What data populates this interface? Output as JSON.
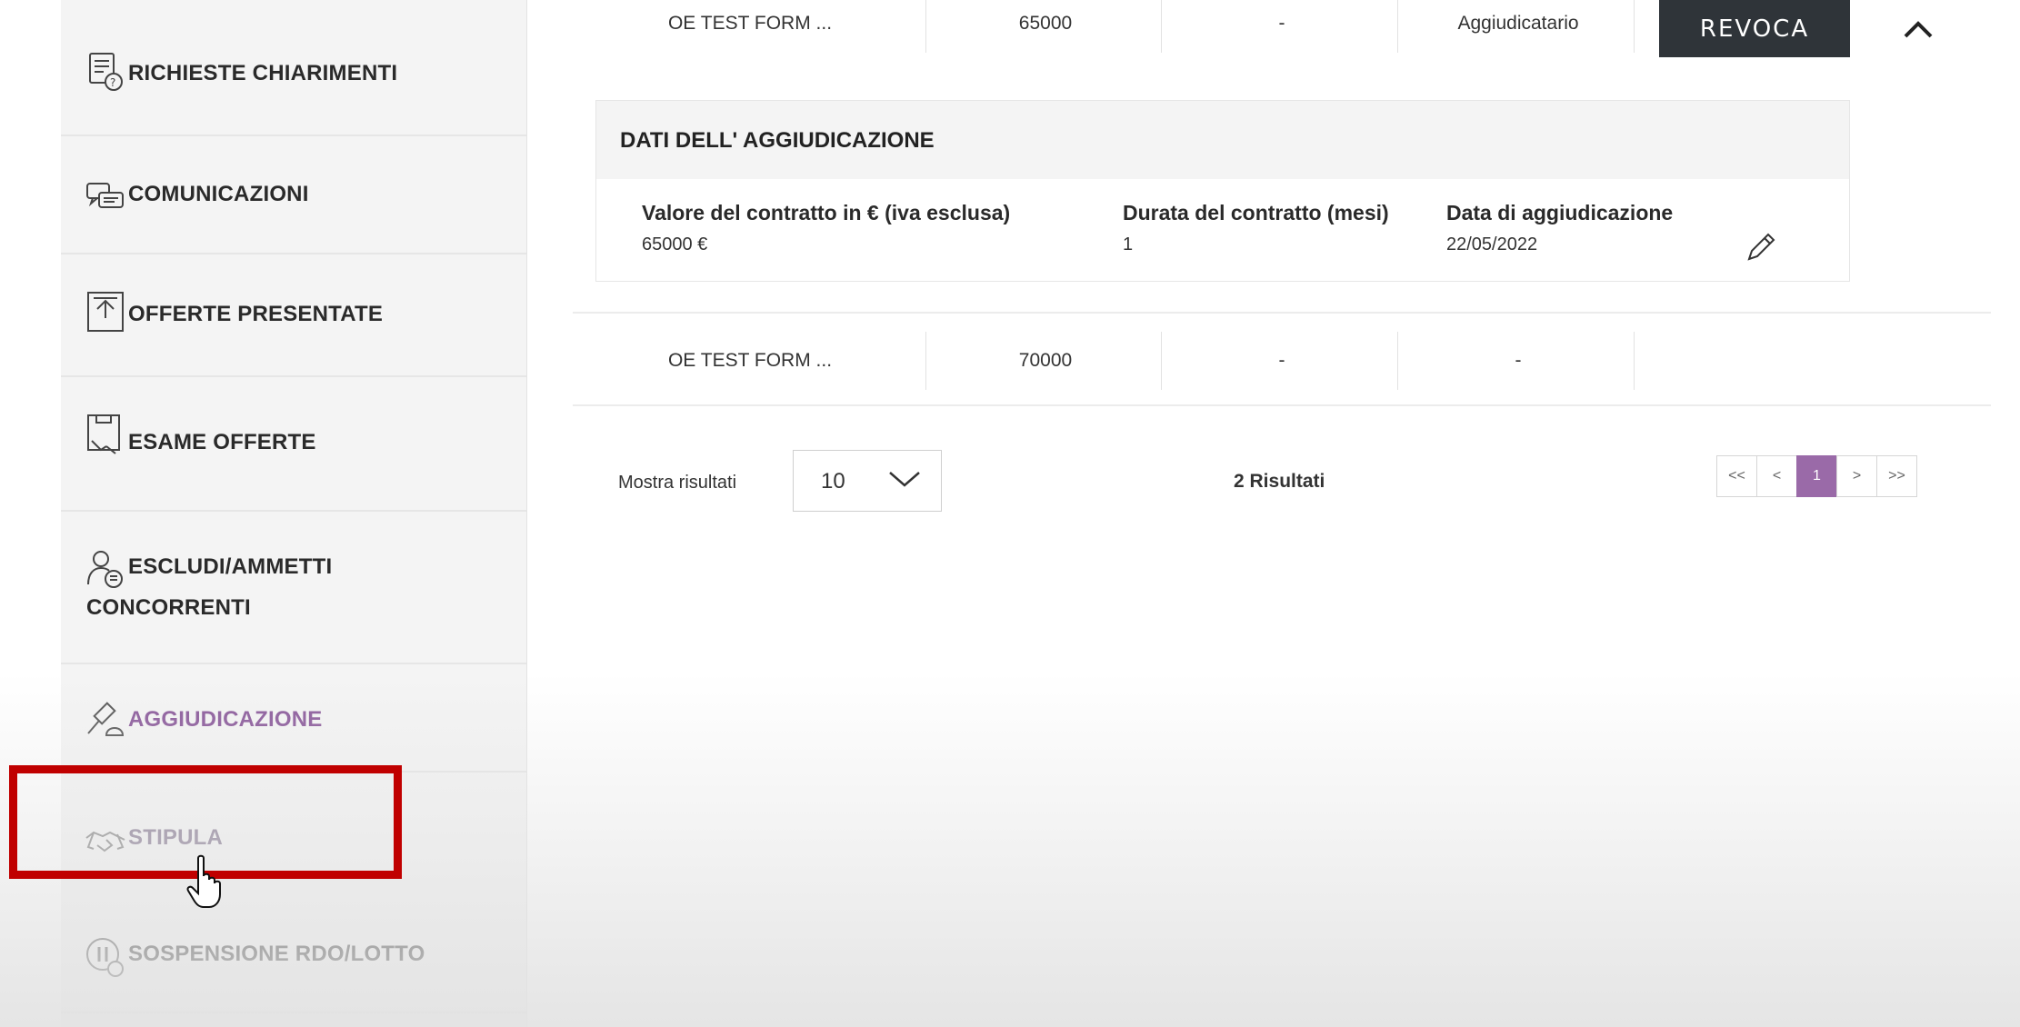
{
  "sidebar": {
    "items": [
      {
        "label": "RICHIESTE CHIARIMENTI",
        "icon": "document-question-icon"
      },
      {
        "label": "COMUNICAZIONI",
        "icon": "chat-bubbles-icon"
      },
      {
        "label": "OFFERTE PRESENTATE",
        "icon": "offer-envelope-icon"
      },
      {
        "label": "ESAME OFFERTE",
        "icon": "document-review-icon"
      },
      {
        "label": "ESCLUDI/AMMETTI CONCORRENTI",
        "icon": "user-list-icon"
      },
      {
        "label": "AGGIUDICAZIONE",
        "icon": "gavel-icon",
        "active": true
      },
      {
        "label": "STIPULA",
        "icon": "handshake-icon",
        "highlighted": true
      },
      {
        "label": "SOSPENSIONE RDO/LOTTO",
        "icon": "pause-circle-icon"
      }
    ]
  },
  "results": {
    "rows": [
      {
        "operatore": "OE TEST FORM ...",
        "offerta": "65000",
        "col3": "-",
        "stato": "Aggiudicatario",
        "action": "REVOCA"
      },
      {
        "operatore": "OE TEST FORM ...",
        "offerta": "70000",
        "col3": "-",
        "stato": "-"
      }
    ],
    "aggiudicazione": {
      "title": "DATI DELL' AGGIUDICAZIONE",
      "valore_label": "Valore del contratto in € (iva esclusa)",
      "valore": "65000 €",
      "durata_label": "Durata del contratto (mesi)",
      "durata": "1",
      "data_label": "Data di aggiudicazione",
      "data": "22/05/2022"
    }
  },
  "pagination": {
    "show_label": "Mostra risultati",
    "page_size": "10",
    "count_text": "2 Risultati",
    "buttons": [
      "<<",
      "<",
      "1",
      ">",
      ">>"
    ],
    "current_page": "1"
  },
  "colors": {
    "accent": "#9a6aa8",
    "highlight": "#c00000",
    "button_dark": "#2f3439"
  }
}
